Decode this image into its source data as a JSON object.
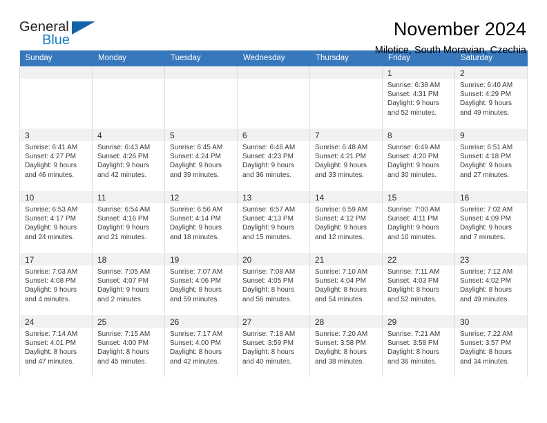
{
  "logo": {
    "word1": "General",
    "word2": "Blue",
    "triangle_color": "#1262a8",
    "blue_color": "#1a7dc4"
  },
  "header": {
    "title": "November 2024",
    "subtitle": "Milotice, South Moravian, Czechia"
  },
  "theme": {
    "header_bg": "#3777bc",
    "header_text": "#ffffff",
    "daynum_band_bg": "#f1f1f1",
    "cell_border": "#dcdcdc"
  },
  "weekday_headers": [
    "Sunday",
    "Monday",
    "Tuesday",
    "Wednesday",
    "Thursday",
    "Friday",
    "Saturday"
  ],
  "weeks": [
    [
      {
        "day": "",
        "empty": true
      },
      {
        "day": "",
        "empty": true
      },
      {
        "day": "",
        "empty": true
      },
      {
        "day": "",
        "empty": true
      },
      {
        "day": "",
        "empty": true
      },
      {
        "day": "1",
        "sunrise": "Sunrise: 6:38 AM",
        "sunset": "Sunset: 4:31 PM",
        "daylight1": "Daylight: 9 hours",
        "daylight2": "and 52 minutes."
      },
      {
        "day": "2",
        "sunrise": "Sunrise: 6:40 AM",
        "sunset": "Sunset: 4:29 PM",
        "daylight1": "Daylight: 9 hours",
        "daylight2": "and 49 minutes."
      }
    ],
    [
      {
        "day": "3",
        "sunrise": "Sunrise: 6:41 AM",
        "sunset": "Sunset: 4:27 PM",
        "daylight1": "Daylight: 9 hours",
        "daylight2": "and 46 minutes."
      },
      {
        "day": "4",
        "sunrise": "Sunrise: 6:43 AM",
        "sunset": "Sunset: 4:26 PM",
        "daylight1": "Daylight: 9 hours",
        "daylight2": "and 42 minutes."
      },
      {
        "day": "5",
        "sunrise": "Sunrise: 6:45 AM",
        "sunset": "Sunset: 4:24 PM",
        "daylight1": "Daylight: 9 hours",
        "daylight2": "and 39 minutes."
      },
      {
        "day": "6",
        "sunrise": "Sunrise: 6:46 AM",
        "sunset": "Sunset: 4:23 PM",
        "daylight1": "Daylight: 9 hours",
        "daylight2": "and 36 minutes."
      },
      {
        "day": "7",
        "sunrise": "Sunrise: 6:48 AM",
        "sunset": "Sunset: 4:21 PM",
        "daylight1": "Daylight: 9 hours",
        "daylight2": "and 33 minutes."
      },
      {
        "day": "8",
        "sunrise": "Sunrise: 6:49 AM",
        "sunset": "Sunset: 4:20 PM",
        "daylight1": "Daylight: 9 hours",
        "daylight2": "and 30 minutes."
      },
      {
        "day": "9",
        "sunrise": "Sunrise: 6:51 AM",
        "sunset": "Sunset: 4:18 PM",
        "daylight1": "Daylight: 9 hours",
        "daylight2": "and 27 minutes."
      }
    ],
    [
      {
        "day": "10",
        "sunrise": "Sunrise: 6:53 AM",
        "sunset": "Sunset: 4:17 PM",
        "daylight1": "Daylight: 9 hours",
        "daylight2": "and 24 minutes."
      },
      {
        "day": "11",
        "sunrise": "Sunrise: 6:54 AM",
        "sunset": "Sunset: 4:16 PM",
        "daylight1": "Daylight: 9 hours",
        "daylight2": "and 21 minutes."
      },
      {
        "day": "12",
        "sunrise": "Sunrise: 6:56 AM",
        "sunset": "Sunset: 4:14 PM",
        "daylight1": "Daylight: 9 hours",
        "daylight2": "and 18 minutes."
      },
      {
        "day": "13",
        "sunrise": "Sunrise: 6:57 AM",
        "sunset": "Sunset: 4:13 PM",
        "daylight1": "Daylight: 9 hours",
        "daylight2": "and 15 minutes."
      },
      {
        "day": "14",
        "sunrise": "Sunrise: 6:59 AM",
        "sunset": "Sunset: 4:12 PM",
        "daylight1": "Daylight: 9 hours",
        "daylight2": "and 12 minutes."
      },
      {
        "day": "15",
        "sunrise": "Sunrise: 7:00 AM",
        "sunset": "Sunset: 4:11 PM",
        "daylight1": "Daylight: 9 hours",
        "daylight2": "and 10 minutes."
      },
      {
        "day": "16",
        "sunrise": "Sunrise: 7:02 AM",
        "sunset": "Sunset: 4:09 PM",
        "daylight1": "Daylight: 9 hours",
        "daylight2": "and 7 minutes."
      }
    ],
    [
      {
        "day": "17",
        "sunrise": "Sunrise: 7:03 AM",
        "sunset": "Sunset: 4:08 PM",
        "daylight1": "Daylight: 9 hours",
        "daylight2": "and 4 minutes."
      },
      {
        "day": "18",
        "sunrise": "Sunrise: 7:05 AM",
        "sunset": "Sunset: 4:07 PM",
        "daylight1": "Daylight: 9 hours",
        "daylight2": "and 2 minutes."
      },
      {
        "day": "19",
        "sunrise": "Sunrise: 7:07 AM",
        "sunset": "Sunset: 4:06 PM",
        "daylight1": "Daylight: 8 hours",
        "daylight2": "and 59 minutes."
      },
      {
        "day": "20",
        "sunrise": "Sunrise: 7:08 AM",
        "sunset": "Sunset: 4:05 PM",
        "daylight1": "Daylight: 8 hours",
        "daylight2": "and 56 minutes."
      },
      {
        "day": "21",
        "sunrise": "Sunrise: 7:10 AM",
        "sunset": "Sunset: 4:04 PM",
        "daylight1": "Daylight: 8 hours",
        "daylight2": "and 54 minutes."
      },
      {
        "day": "22",
        "sunrise": "Sunrise: 7:11 AM",
        "sunset": "Sunset: 4:03 PM",
        "daylight1": "Daylight: 8 hours",
        "daylight2": "and 52 minutes."
      },
      {
        "day": "23",
        "sunrise": "Sunrise: 7:12 AM",
        "sunset": "Sunset: 4:02 PM",
        "daylight1": "Daylight: 8 hours",
        "daylight2": "and 49 minutes."
      }
    ],
    [
      {
        "day": "24",
        "sunrise": "Sunrise: 7:14 AM",
        "sunset": "Sunset: 4:01 PM",
        "daylight1": "Daylight: 8 hours",
        "daylight2": "and 47 minutes."
      },
      {
        "day": "25",
        "sunrise": "Sunrise: 7:15 AM",
        "sunset": "Sunset: 4:00 PM",
        "daylight1": "Daylight: 8 hours",
        "daylight2": "and 45 minutes."
      },
      {
        "day": "26",
        "sunrise": "Sunrise: 7:17 AM",
        "sunset": "Sunset: 4:00 PM",
        "daylight1": "Daylight: 8 hours",
        "daylight2": "and 42 minutes."
      },
      {
        "day": "27",
        "sunrise": "Sunrise: 7:18 AM",
        "sunset": "Sunset: 3:59 PM",
        "daylight1": "Daylight: 8 hours",
        "daylight2": "and 40 minutes."
      },
      {
        "day": "28",
        "sunrise": "Sunrise: 7:20 AM",
        "sunset": "Sunset: 3:58 PM",
        "daylight1": "Daylight: 8 hours",
        "daylight2": "and 38 minutes."
      },
      {
        "day": "29",
        "sunrise": "Sunrise: 7:21 AM",
        "sunset": "Sunset: 3:58 PM",
        "daylight1": "Daylight: 8 hours",
        "daylight2": "and 36 minutes."
      },
      {
        "day": "30",
        "sunrise": "Sunrise: 7:22 AM",
        "sunset": "Sunset: 3:57 PM",
        "daylight1": "Daylight: 8 hours",
        "daylight2": "and 34 minutes."
      }
    ]
  ]
}
